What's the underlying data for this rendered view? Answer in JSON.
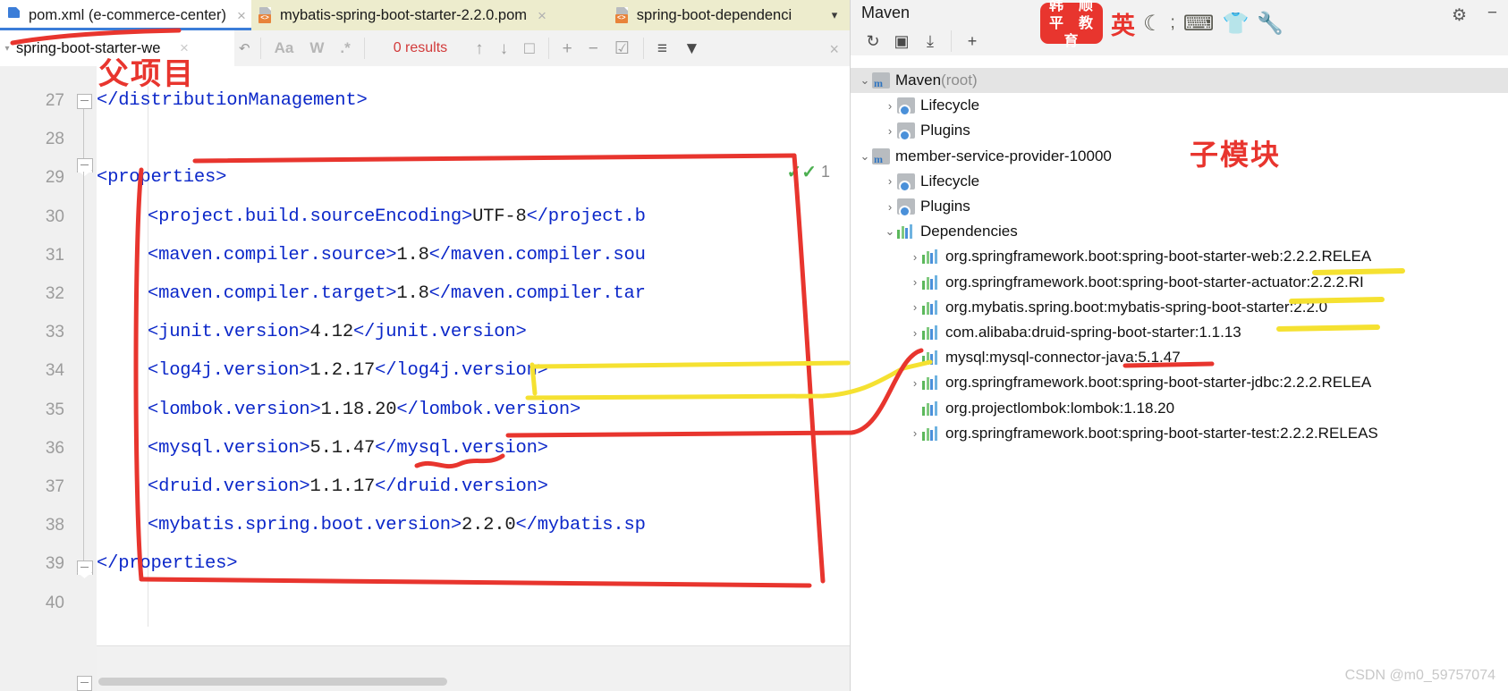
{
  "tabs": [
    {
      "label": "pom.xml (e-commerce-center)",
      "active": true,
      "icon": "xml-file-icon",
      "close": "×"
    },
    {
      "label": "mybatis-spring-boot-starter-2.2.0.pom",
      "active": false,
      "icon": "xml-file-icon",
      "close": "×"
    },
    {
      "label": "spring-boot-dependenci",
      "active": false,
      "icon": "xml-file-icon",
      "close": ""
    }
  ],
  "tab_dropdown_icon": "▾",
  "find": {
    "value": "spring-boot-starter-we",
    "placeholder": "",
    "history_icon": "▾",
    "clear_icon": "×",
    "regex_history_icon": "↶",
    "match_case_label": "Aa",
    "words_label": "W",
    "regex_label": ".*",
    "results_text": "0 results",
    "prev_icon": "↑",
    "next_icon": "↓",
    "select_all_icon": "□",
    "add_icon": "+",
    "remove_icon": "−",
    "check_icon": "☑",
    "indent_icon": "≡",
    "filter_icon": "▼",
    "close_icon": "×"
  },
  "editor": {
    "line_numbers": [
      "27",
      "28",
      "29",
      "30",
      "31",
      "32",
      "33",
      "34",
      "35",
      "36",
      "37",
      "38",
      "39",
      "40"
    ],
    "inspection_count": "1",
    "inspection_icon": "check-check",
    "lines": [
      {
        "num": "27",
        "indent": 0,
        "parts": [
          {
            "t": "</distributionManagement>",
            "c": "tg"
          }
        ]
      },
      {
        "num": "28",
        "indent": 0,
        "parts": []
      },
      {
        "num": "29",
        "indent": 0,
        "parts": [
          {
            "t": "<properties>",
            "c": "tg"
          }
        ]
      },
      {
        "num": "30",
        "indent": 1,
        "parts": [
          {
            "t": "<project.build.sourceEncoding>",
            "c": "tg"
          },
          {
            "t": "UTF-8",
            "c": "val"
          },
          {
            "t": "</project.b",
            "c": "tg"
          }
        ]
      },
      {
        "num": "31",
        "indent": 1,
        "parts": [
          {
            "t": "<maven.compiler.source>",
            "c": "tg"
          },
          {
            "t": "1.8",
            "c": "val"
          },
          {
            "t": "</maven.compiler.sou",
            "c": "tg"
          }
        ]
      },
      {
        "num": "32",
        "indent": 1,
        "parts": [
          {
            "t": "<maven.compiler.target>",
            "c": "tg"
          },
          {
            "t": "1.8",
            "c": "val"
          },
          {
            "t": "</maven.compiler.tar",
            "c": "tg"
          }
        ]
      },
      {
        "num": "33",
        "indent": 1,
        "parts": [
          {
            "t": "<junit.version>",
            "c": "tg"
          },
          {
            "t": "4.12",
            "c": "val"
          },
          {
            "t": "</junit.version>",
            "c": "tg"
          }
        ]
      },
      {
        "num": "34",
        "indent": 1,
        "parts": [
          {
            "t": "<log4j.version>",
            "c": "tg"
          },
          {
            "t": "1.2.17",
            "c": "val"
          },
          {
            "t": "</log4j.version>",
            "c": "tg"
          }
        ]
      },
      {
        "num": "35",
        "indent": 1,
        "parts": [
          {
            "t": "<lombok.version>",
            "c": "tg"
          },
          {
            "t": "1.18.20",
            "c": "val"
          },
          {
            "t": "</lombok.version>",
            "c": "tg"
          }
        ]
      },
      {
        "num": "36",
        "indent": 1,
        "parts": [
          {
            "t": "<mysql.version>",
            "c": "tg"
          },
          {
            "t": "5.1.47",
            "c": "val"
          },
          {
            "t": "</mysql.version>",
            "c": "tg"
          }
        ]
      },
      {
        "num": "37",
        "indent": 1,
        "parts": [
          {
            "t": "<druid.version>",
            "c": "tg"
          },
          {
            "t": "1.1.17",
            "c": "val"
          },
          {
            "t": "</druid.version>",
            "c": "tg"
          }
        ]
      },
      {
        "num": "38",
        "indent": 1,
        "parts": [
          {
            "t": "<mybatis.spring.boot.version>",
            "c": "tg"
          },
          {
            "t": "2.2.0",
            "c": "val"
          },
          {
            "t": "</mybatis.sp",
            "c": "tg"
          }
        ]
      },
      {
        "num": "39",
        "indent": 0,
        "parts": [
          {
            "t": "</properties>",
            "c": "tg"
          }
        ]
      },
      {
        "num": "40",
        "indent": 0,
        "parts": []
      }
    ]
  },
  "maven": {
    "title": "Maven",
    "toolbar": {
      "reload_icon": "↻",
      "attach_icon": "▣",
      "download_icon": "⤓",
      "add_icon": "+",
      "settings_icon": "⚙",
      "minimize_icon": "−"
    },
    "ime": {
      "logo_chars": [
        "韩",
        "顺",
        "平",
        "教",
        "育"
      ],
      "lang": "英",
      "moon_icon": "☾",
      "semicolon": ";",
      "keyboard_icon": "⌨",
      "clothes_icon": "👕",
      "wrench_icon": "🔧"
    },
    "tree": [
      {
        "depth": 0,
        "label": "Maven",
        "suffix": "(root)",
        "arrow": "⌄",
        "icon": "maven-module-icon",
        "selected": true
      },
      {
        "depth": 1,
        "label": "Lifecycle",
        "suffix": "",
        "arrow": "›",
        "icon": "folder-gear-icon",
        "selected": false
      },
      {
        "depth": 1,
        "label": "Plugins",
        "suffix": "",
        "arrow": "›",
        "icon": "folder-gear-icon",
        "selected": false
      },
      {
        "depth": 0,
        "label": "member-service-provider-10000",
        "suffix": "",
        "arrow": "⌄",
        "icon": "maven-module-icon",
        "selected": false
      },
      {
        "depth": 1,
        "label": "Lifecycle",
        "suffix": "",
        "arrow": "›",
        "icon": "folder-gear-icon",
        "selected": false
      },
      {
        "depth": 1,
        "label": "Plugins",
        "suffix": "",
        "arrow": "›",
        "icon": "folder-gear-icon",
        "selected": false
      },
      {
        "depth": 1,
        "label": "Dependencies",
        "suffix": "",
        "arrow": "⌄",
        "icon": "bars-icon",
        "selected": false
      },
      {
        "depth": 2,
        "label": "org.springframework.boot:spring-boot-starter-web:2.2.2.RELEA",
        "suffix": "",
        "arrow": "›",
        "icon": "bars-icon",
        "selected": false
      },
      {
        "depth": 2,
        "label": "org.springframework.boot:spring-boot-starter-actuator:2.2.2.RI",
        "suffix": "",
        "arrow": "›",
        "icon": "bars-icon",
        "selected": false
      },
      {
        "depth": 2,
        "label": "org.mybatis.spring.boot:mybatis-spring-boot-starter:2.2.0",
        "suffix": "",
        "arrow": "›",
        "icon": "bars-icon",
        "selected": false
      },
      {
        "depth": 2,
        "label": "com.alibaba:druid-spring-boot-starter:1.1.13",
        "suffix": "",
        "arrow": "›",
        "icon": "bars-icon",
        "selected": false
      },
      {
        "depth": 2,
        "label": "mysql:mysql-connector-java:5.1.47",
        "suffix": "",
        "arrow": "",
        "icon": "bars-icon",
        "selected": false
      },
      {
        "depth": 2,
        "label": "org.springframework.boot:spring-boot-starter-jdbc:2.2.2.RELEA",
        "suffix": "",
        "arrow": "›",
        "icon": "bars-icon",
        "selected": false
      },
      {
        "depth": 2,
        "label": "org.projectlombok:lombok:1.18.20",
        "suffix": "",
        "arrow": "",
        "icon": "bars-icon",
        "selected": false
      },
      {
        "depth": 2,
        "label": "org.springframework.boot:spring-boot-starter-test:2.2.2.RELEAS",
        "suffix": "",
        "arrow": "›",
        "icon": "bars-icon",
        "selected": false
      }
    ]
  },
  "annotations": {
    "parent_project_label": "父项目",
    "submodule_label": "子模块",
    "red_color": "#e8352e",
    "yellow_color": "#f5e131"
  },
  "watermark": "CSDN @m0_59757074"
}
